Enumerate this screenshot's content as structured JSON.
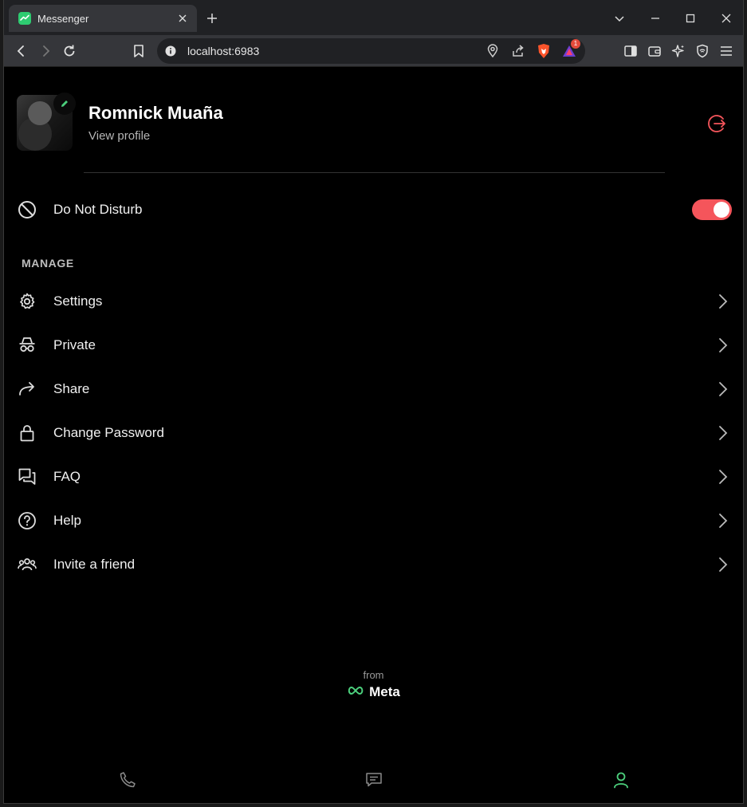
{
  "browser": {
    "tab": {
      "title": "Messenger"
    },
    "address": {
      "url": "localhost:6983"
    },
    "shield_badge": "1"
  },
  "profile": {
    "name": "Romnick Muaña",
    "view_profile": "View profile"
  },
  "dnd": {
    "label": "Do Not Disturb",
    "enabled": true
  },
  "manage": {
    "header": "MANAGE",
    "items": [
      {
        "label": "Settings",
        "icon": "gear-icon"
      },
      {
        "label": "Private",
        "icon": "incognito-icon"
      },
      {
        "label": "Share",
        "icon": "share-arrow-icon"
      },
      {
        "label": "Change Password",
        "icon": "lock-icon"
      },
      {
        "label": "FAQ",
        "icon": "chat-bubbles-icon"
      },
      {
        "label": "Help",
        "icon": "question-circle-icon"
      },
      {
        "label": "Invite a friend",
        "icon": "group-icon"
      }
    ]
  },
  "footer": {
    "from": "from",
    "brand": "Meta"
  },
  "colors": {
    "accent_red": "#f5555b",
    "accent_green": "#4cd07d",
    "background": "#000000"
  },
  "bottom_nav": {
    "active": "profile"
  }
}
